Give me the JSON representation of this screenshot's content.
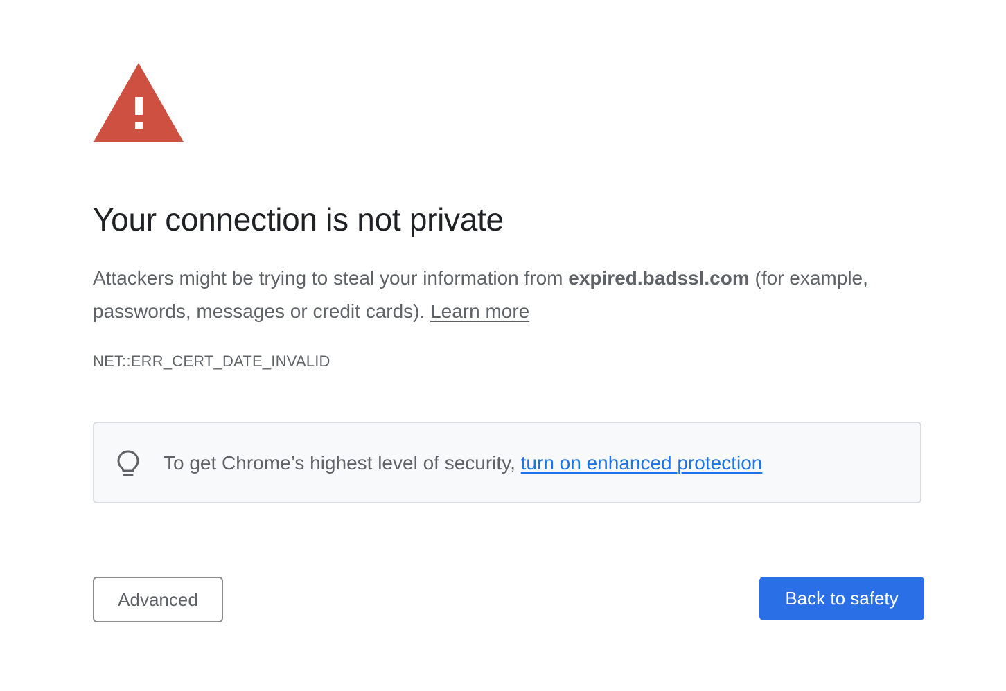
{
  "warning": {
    "icon": "warning-triangle-icon",
    "color": "#cd5040"
  },
  "title": "Your connection is not private",
  "message": {
    "prefix": "Attackers might be trying to steal your information from ",
    "host": "expired.badssl.com",
    "suffix": " (for example, passwords, messages or credit cards). ",
    "learn_more": "Learn more"
  },
  "error_code": "NET::ERR_CERT_DATE_INVALID",
  "promo": {
    "icon": "lightbulb-icon",
    "text": "To get Chrome’s highest level of security, ",
    "link": "turn on enhanced protection",
    "link_color": "#1a73e8"
  },
  "buttons": {
    "advanced": "Advanced",
    "back_to_safety": "Back to safety",
    "primary_color": "#2a6fe6"
  }
}
